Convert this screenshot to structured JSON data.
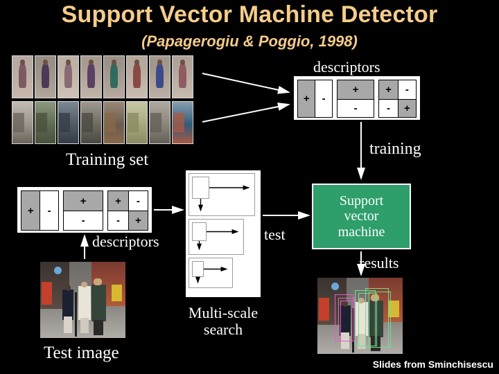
{
  "slide": {
    "title": "Support Vector Machine Detector",
    "subtitle": "(Papagerogiu & Poggio, 1998)",
    "background_color": "#000000",
    "title_color": "#F5CC8A",
    "credit": "Slides from Sminchisescu"
  },
  "labels": {
    "training_set": "Training set",
    "descriptors_top": "descriptors",
    "descriptors_bottom": "descriptors",
    "training": "training",
    "test": "test",
    "results": "results",
    "multi_scale_line1": "Multi-scale",
    "multi_scale_line2": "search",
    "test_image": "Test image"
  },
  "svm_box": {
    "line1": "Support",
    "line2": "vector",
    "line3": "machine",
    "fill_color": "#2E9E6B",
    "border_color": "#FFFFFF",
    "text_color": "#FFFFFF"
  },
  "descriptor_panel": {
    "gray_color": "#A8A8A8",
    "white_color": "#FFFFFF",
    "cells": [
      {
        "name": "vertical-two-part",
        "layout": "vertical-split",
        "parts": [
          {
            "sign": "+",
            "shade": "gray"
          },
          {
            "sign": "-",
            "shade": "white"
          }
        ]
      },
      {
        "name": "horizontal-two-part",
        "layout": "horizontal-split",
        "parts": [
          {
            "sign": "+",
            "shade": "gray"
          },
          {
            "sign": "-",
            "shade": "white"
          }
        ]
      },
      {
        "name": "checkerboard-four-part",
        "layout": "quad-split",
        "parts": [
          {
            "sign": "+",
            "shade": "gray"
          },
          {
            "sign": "-",
            "shade": "white"
          },
          {
            "sign": "-",
            "shade": "white"
          },
          {
            "sign": "+",
            "shade": "gray"
          }
        ]
      }
    ]
  },
  "multi_scale": {
    "scales": [
      {
        "label": "scale-large"
      },
      {
        "label": "scale-medium"
      },
      {
        "label": "scale-small"
      }
    ]
  },
  "training_set": {
    "positive_row_label": "pedestrian-examples",
    "negative_row_label": "background-examples",
    "positive_count": 8,
    "negative_count": 8
  },
  "images": {
    "test_image_caption": "street-scene-with-pedestrians",
    "results_image_caption": "street-scene-with-detection-boxes",
    "detection_box_colors": [
      "#6FE08F",
      "#E060C0"
    ]
  }
}
